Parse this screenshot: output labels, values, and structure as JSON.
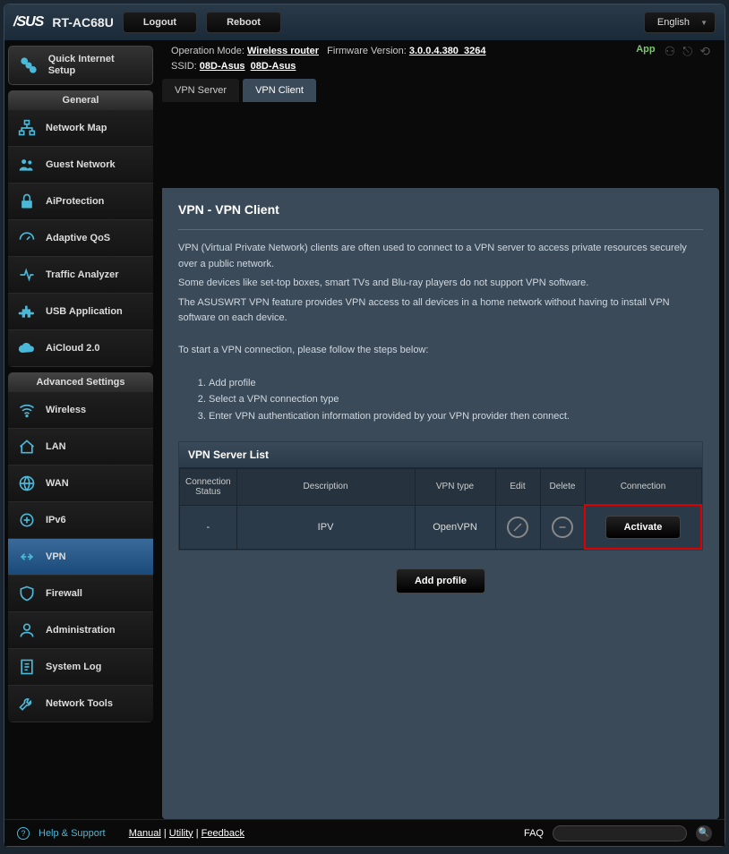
{
  "brand": "/SUS",
  "model": "RT-AC68U",
  "top_buttons": {
    "logout": "Logout",
    "reboot": "Reboot",
    "language": "English"
  },
  "info": {
    "op_mode_label": "Operation Mode:",
    "op_mode": "Wireless router",
    "fw_label": "Firmware Version:",
    "fw": "3.0.0.4.380_3264",
    "ssid_label": "SSID:",
    "ssid1": "08D-Asus",
    "ssid2": "08D-Asus",
    "app": "App"
  },
  "tabs": {
    "server": "VPN Server",
    "client": "VPN Client"
  },
  "sidebar": {
    "quick_setup": "Quick Internet Setup",
    "general_header": "General",
    "general": [
      "Network Map",
      "Guest Network",
      "AiProtection",
      "Adaptive QoS",
      "Traffic Analyzer",
      "USB Application",
      "AiCloud 2.0"
    ],
    "advanced_header": "Advanced Settings",
    "advanced": [
      "Wireless",
      "LAN",
      "WAN",
      "IPv6",
      "VPN",
      "Firewall",
      "Administration",
      "System Log",
      "Network Tools"
    ]
  },
  "panel": {
    "title": "VPN - VPN Client",
    "para1": "VPN (Virtual Private Network) clients are often used to connect to a VPN server to access private resources securely over a public network.",
    "para2": "Some devices like set-top boxes, smart TVs and Blu-ray players do not support VPN software.",
    "para3": "The ASUSWRT VPN feature provides VPN access to all devices in a home network without having to install VPN software on each device.",
    "para4": "To start a VPN connection, please follow the steps below:",
    "steps": [
      "Add profile",
      "Select a VPN connection type",
      "Enter VPN authentication information provided by your VPN provider then connect."
    ],
    "table_title": "VPN Server List",
    "headers": {
      "status": "Connection Status",
      "desc": "Description",
      "type": "VPN type",
      "edit": "Edit",
      "delete": "Delete",
      "conn": "Connection"
    },
    "row": {
      "status": "-",
      "desc": "IPV",
      "type": "OpenVPN",
      "activate": "Activate"
    },
    "add_profile": "Add profile"
  },
  "footer": {
    "help": "Help & Support",
    "manual": "Manual",
    "utility": "Utility",
    "feedback": "Feedback",
    "faq": "FAQ"
  }
}
